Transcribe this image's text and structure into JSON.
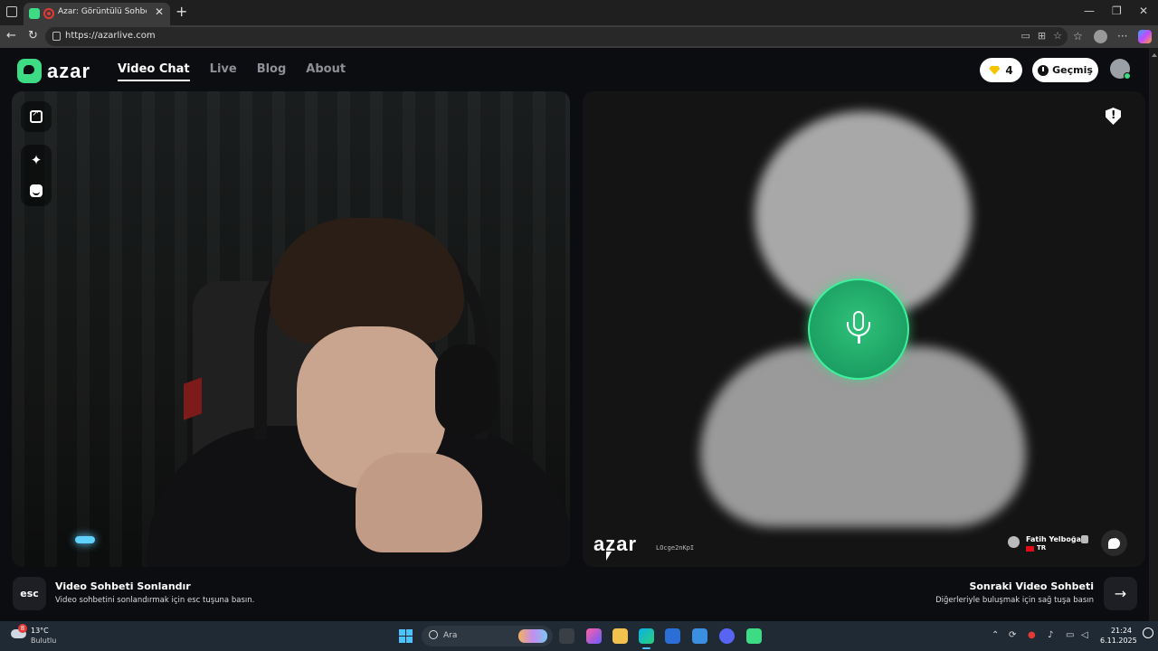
{
  "browser": {
    "tab_title": "Azar: Görüntülü Sohbet, Yeni",
    "url": "https://azarlive.com"
  },
  "site": {
    "logo_text": "azar",
    "nav": [
      {
        "label": "Video Chat",
        "active": true
      },
      {
        "label": "Live",
        "active": false
      },
      {
        "label": "Blog",
        "active": false
      },
      {
        "label": "About",
        "active": false
      }
    ],
    "gem_count": "4",
    "history_label": "Geçmiş"
  },
  "remote": {
    "watermark": "azar",
    "watermark_id": "LOcge2nKpI",
    "peer_name": "Fatih Yelboğa",
    "peer_country": "TR"
  },
  "controls": {
    "end_key": "esc",
    "end_title": "Video Sohbeti Sonlandır",
    "end_desc": "Video sohbetini sonlandırmak için esc tuşuna basın.",
    "next_title": "Sonraki Video Sohbeti",
    "next_desc": "Diğerleriyle buluşmak için sağ tuşa basın"
  },
  "taskbar": {
    "weather_badge": "8",
    "temperature": "13°C",
    "condition": "Bulutlu",
    "search_placeholder": "Ara",
    "time": "21:24",
    "date": "6.11.2025"
  },
  "colors": {
    "brand": "#3ddc84",
    "page_bg": "#0c0d10",
    "gem": "#f5c400"
  }
}
